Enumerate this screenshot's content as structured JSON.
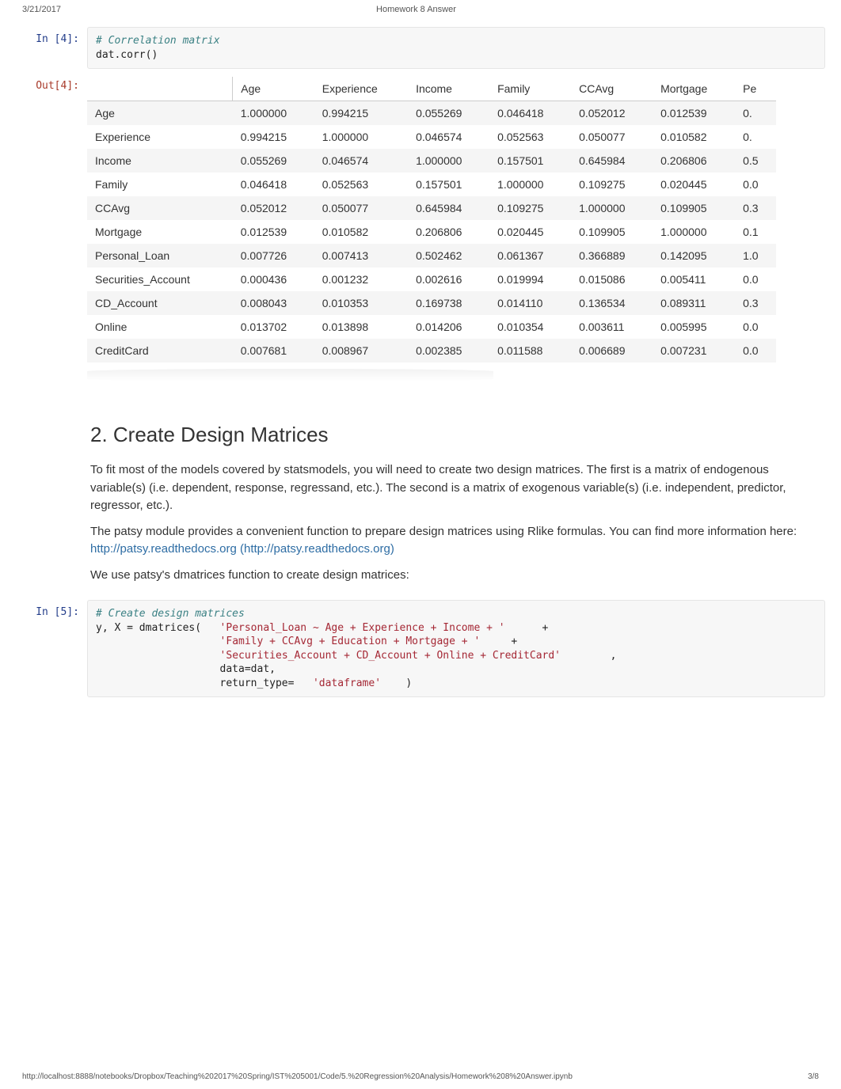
{
  "header": {
    "date": "3/21/2017",
    "title": "Homework 8 Answer"
  },
  "footer": {
    "url": "http://localhost:8888/notebooks/Dropbox/Teaching%202017%20Spring/IST%205001/Code/5.%20Regression%20Analysis/Homework%208%20Answer.ipynb",
    "page": "3/8"
  },
  "cells": {
    "in4": {
      "prompt": "In [4]:",
      "code_comment": "# Correlation matrix",
      "code_line": "dat.corr()"
    },
    "out4": {
      "prompt": "Out[4]:",
      "columns": [
        "Age",
        "Experience",
        "Income",
        "Family",
        "CCAvg",
        "Mortgage",
        "Pe"
      ],
      "rows": [
        {
          "name": "Age",
          "v": [
            "1.000000",
            "0.994215",
            "0.055269",
            "0.046418",
            "0.052012",
            "0.012539",
            "0."
          ]
        },
        {
          "name": "Experience",
          "v": [
            "0.994215",
            "1.000000",
            "0.046574",
            "0.052563",
            "0.050077",
            "0.010582",
            "0."
          ]
        },
        {
          "name": "Income",
          "v": [
            "0.055269",
            "0.046574",
            "1.000000",
            "0.157501",
            "0.645984",
            "0.206806",
            "0.5"
          ]
        },
        {
          "name": "Family",
          "v": [
            "0.046418",
            "0.052563",
            "0.157501",
            "1.000000",
            "0.109275",
            "0.020445",
            "0.0"
          ]
        },
        {
          "name": "CCAvg",
          "v": [
            "0.052012",
            "0.050077",
            "0.645984",
            "0.109275",
            "1.000000",
            "0.109905",
            "0.3"
          ]
        },
        {
          "name": "Mortgage",
          "v": [
            "0.012539",
            "0.010582",
            "0.206806",
            "0.020445",
            "0.109905",
            "1.000000",
            "0.1"
          ]
        },
        {
          "name": "Personal_Loan",
          "v": [
            "0.007726",
            "0.007413",
            "0.502462",
            "0.061367",
            "0.366889",
            "0.142095",
            "1.0"
          ]
        },
        {
          "name": "Securities_Account",
          "v": [
            "0.000436",
            "0.001232",
            "0.002616",
            "0.019994",
            "0.015086",
            "0.005411",
            "0.0"
          ]
        },
        {
          "name": "CD_Account",
          "v": [
            "0.008043",
            "0.010353",
            "0.169738",
            "0.014110",
            "0.136534",
            "0.089311",
            "0.3"
          ]
        },
        {
          "name": "Online",
          "v": [
            "0.013702",
            "0.013898",
            "0.014206",
            "0.010354",
            "0.003611",
            "0.005995",
            "0.0"
          ]
        },
        {
          "name": "CreditCard",
          "v": [
            "0.007681",
            "0.008967",
            "0.002385",
            "0.011588",
            "0.006689",
            "0.007231",
            "0.0"
          ]
        }
      ]
    },
    "md": {
      "heading": "2. Create Design Matrices",
      "p1": "To fit most of the models covered by statsmodels, you will need to create two design matrices. The first is a matrix of endogenous variable(s) (i.e. dependent, response, regressand, etc.). The second is a matrix of exogenous variable(s) (i.e. independent, predictor, regressor, etc.).",
      "p2a": "The patsy module provides a convenient function to prepare design matrices using Rlike formulas. You can find more information here: ",
      "p2link": "http://patsy.readthedocs.org (http://patsy.readthedocs.org)",
      "p3": "We use patsy's dmatrices function to create design matrices:"
    },
    "in5": {
      "prompt": "In [5]:",
      "comment": "# Create design matrices",
      "l1a": "y, X = dmatrices(   ",
      "l1b": "'Personal_Loan ~ Age + Experience + Income + '",
      "l1c": "      +",
      "l2b": "'Family + CCAvg + Education + Mortgage + '",
      "l2c": "     +",
      "l3b": "'Securities_Account + CD_Account + Online + CreditCard'",
      "l3c": "        ,",
      "l4": "                    data=dat,",
      "l5a": "                    return_type=   ",
      "l5b": "'dataframe'",
      "l5c": "    )"
    }
  }
}
